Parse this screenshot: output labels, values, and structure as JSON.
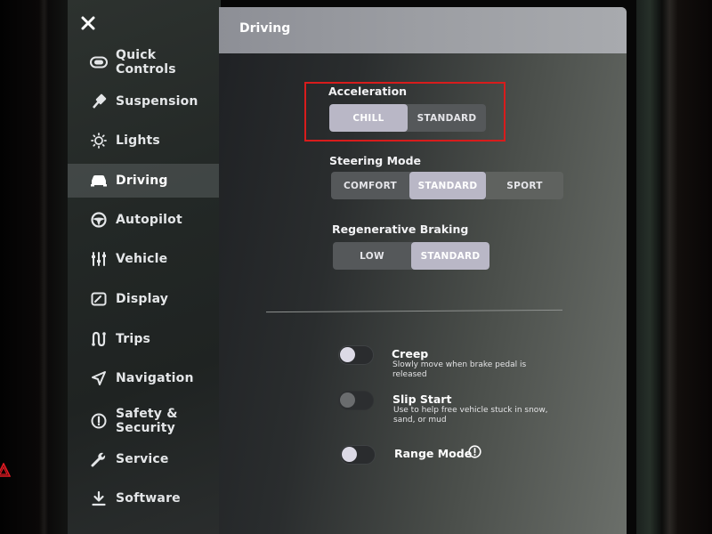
{
  "sidebar": {
    "close_icon": "close-icon",
    "items": [
      {
        "label": "Quick Controls",
        "icon": "toggle-icon",
        "active": false
      },
      {
        "label": "Suspension",
        "icon": "shock-absorber-icon",
        "active": false
      },
      {
        "label": "Lights",
        "icon": "sun-icon",
        "active": false
      },
      {
        "label": "Driving",
        "icon": "car-icon",
        "active": true
      },
      {
        "label": "Autopilot",
        "icon": "steering-wheel-icon",
        "active": false
      },
      {
        "label": "Vehicle",
        "icon": "sliders-icon",
        "active": false
      },
      {
        "label": "Display",
        "icon": "display-icon",
        "active": false
      },
      {
        "label": "Trips",
        "icon": "route-icon",
        "active": false
      },
      {
        "label": "Navigation",
        "icon": "navigation-arrow-icon",
        "active": false
      },
      {
        "label": "Safety &\nSecurity",
        "label_line1": "Safety &",
        "label_line2": "Security",
        "icon": "alert-circle-icon",
        "active": false
      },
      {
        "label": "Service",
        "icon": "wrench-icon",
        "active": false
      },
      {
        "label": "Software",
        "icon": "download-icon",
        "active": false
      }
    ]
  },
  "header": {
    "title": "Driving"
  },
  "settings": {
    "acceleration": {
      "label": "Acceleration",
      "options": [
        "CHILL",
        "STANDARD"
      ],
      "selected": "CHILL"
    },
    "steering_mode": {
      "label": "Steering Mode",
      "options": [
        "COMFORT",
        "STANDARD",
        "SPORT"
      ],
      "selected": "STANDARD"
    },
    "regenerative_braking": {
      "label": "Regenerative Braking",
      "options": [
        "LOW",
        "STANDARD"
      ],
      "selected": "STANDARD"
    },
    "toggles": [
      {
        "title": "Creep",
        "description": "Slowly move when brake pedal is released",
        "state": "off",
        "enabled": true
      },
      {
        "title": "Slip Start",
        "description": "Use to help free vehicle stuck in snow, sand, or mud",
        "state": "off",
        "enabled": false
      },
      {
        "title": "Range Mode",
        "description": "",
        "state": "off",
        "enabled": true,
        "info_icon": "info-icon"
      }
    ]
  },
  "annotation": {
    "highlight_color": "#d81c1c",
    "highlight_target": "acceleration"
  },
  "colors": {
    "selected_segment": "#b9b7c6",
    "header_bg": "#9c9ea3",
    "sidebar_bg": "#242927"
  }
}
